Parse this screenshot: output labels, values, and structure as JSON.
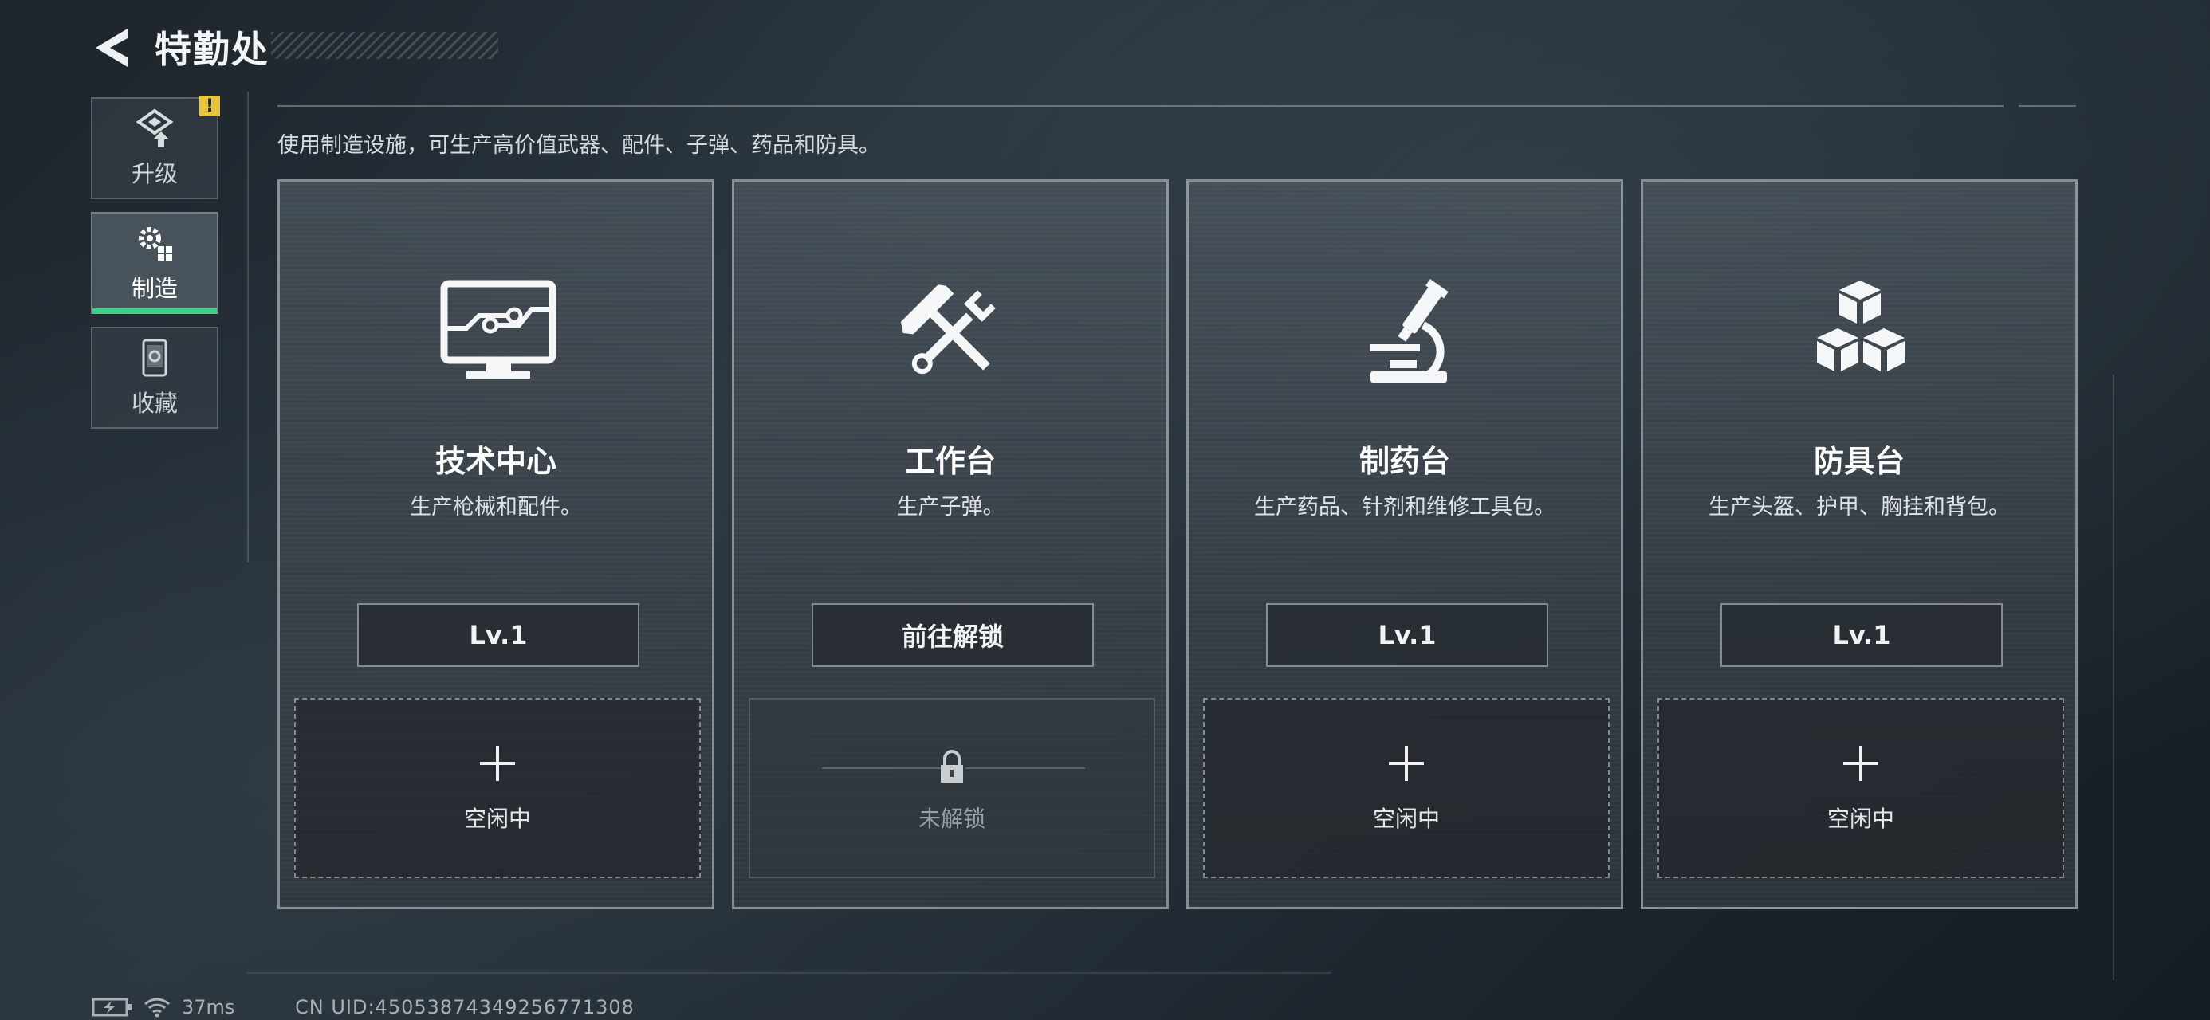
{
  "header": {
    "title": "特勤处"
  },
  "sidebar": {
    "badge": "!",
    "items": [
      {
        "label": "升级",
        "icon": "upgrade-icon"
      },
      {
        "label": "制造",
        "icon": "gear-grid-icon",
        "active": true
      },
      {
        "label": "收藏",
        "icon": "collection-icon"
      }
    ]
  },
  "description": "使用制造设施，可生产高价值武器、配件、子弹、药品和防具。",
  "cards": [
    {
      "title": "技术中心",
      "desc": "生产枪械和配件。",
      "button": "Lv.1",
      "slot": "空闲中",
      "icon": "monitor-circuit-icon"
    },
    {
      "title": "工作台",
      "desc": "生产子弹。",
      "button": "前往解锁",
      "slot": "未解锁",
      "icon": "hammer-wrench-icon"
    },
    {
      "title": "制药台",
      "desc": "生产药品、针剂和维修工具包。",
      "button": "Lv.1",
      "slot": "空闲中",
      "icon": "microscope-icon"
    },
    {
      "title": "防具台",
      "desc": "生产头盔、护甲、胸挂和背包。",
      "button": "Lv.1",
      "slot": "空闲中",
      "icon": "cubes-icon"
    }
  ],
  "status": {
    "ping": "37ms",
    "uid": "CN UID:450538743492567713​08"
  },
  "colors": {
    "accent": "#3fd18a",
    "badge": "#e8c53a"
  }
}
